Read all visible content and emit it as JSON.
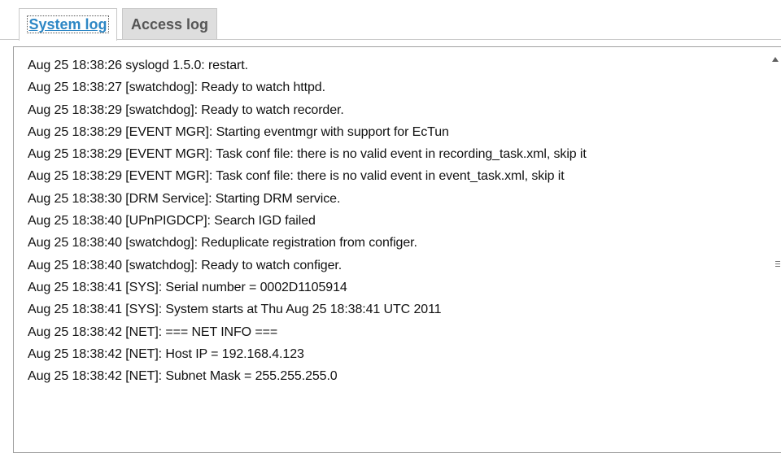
{
  "tabs": {
    "system_log": "System log",
    "access_log": "Access log"
  },
  "log_lines": [
    "Aug 25 18:38:26 syslogd 1.5.0: restart.",
    "Aug 25 18:38:27 [swatchdog]: Ready to watch httpd.",
    "Aug 25 18:38:29 [swatchdog]: Ready to watch recorder.",
    "Aug 25 18:38:29 [EVENT MGR]: Starting eventmgr with support for EcTun",
    "Aug 25 18:38:29 [EVENT MGR]: Task conf file: there is no valid event in recording_task.xml, skip it",
    "Aug 25 18:38:29 [EVENT MGR]: Task conf file: there is no valid event in event_task.xml, skip it",
    "Aug 25 18:38:30 [DRM Service]: Starting DRM service.",
    "Aug 25 18:38:40 [UPnPIGDCP]: Search IGD failed",
    "Aug 25 18:38:40 [swatchdog]: Reduplicate registration from configer.",
    "Aug 25 18:38:40 [swatchdog]: Ready to watch configer.",
    "Aug 25 18:38:41 [SYS]: Serial number = 0002D1105914",
    "Aug 25 18:38:41 [SYS]: System starts at Thu Aug 25 18:38:41 UTC 2011",
    "Aug 25 18:38:42 [NET]: === NET INFO ===",
    "Aug 25 18:38:42 [NET]: Host IP = 192.168.4.123",
    "Aug 25 18:38:42 [NET]: Subnet Mask = 255.255.255.0"
  ],
  "colors": {
    "active_tab_text": "#2e87c5",
    "inactive_tab_bg": "#dedede",
    "border": "#a0a0a0"
  },
  "icons": {
    "scroll_up": "scroll-up-arrow-icon",
    "scroll_grip": "scroll-grip-icon"
  }
}
